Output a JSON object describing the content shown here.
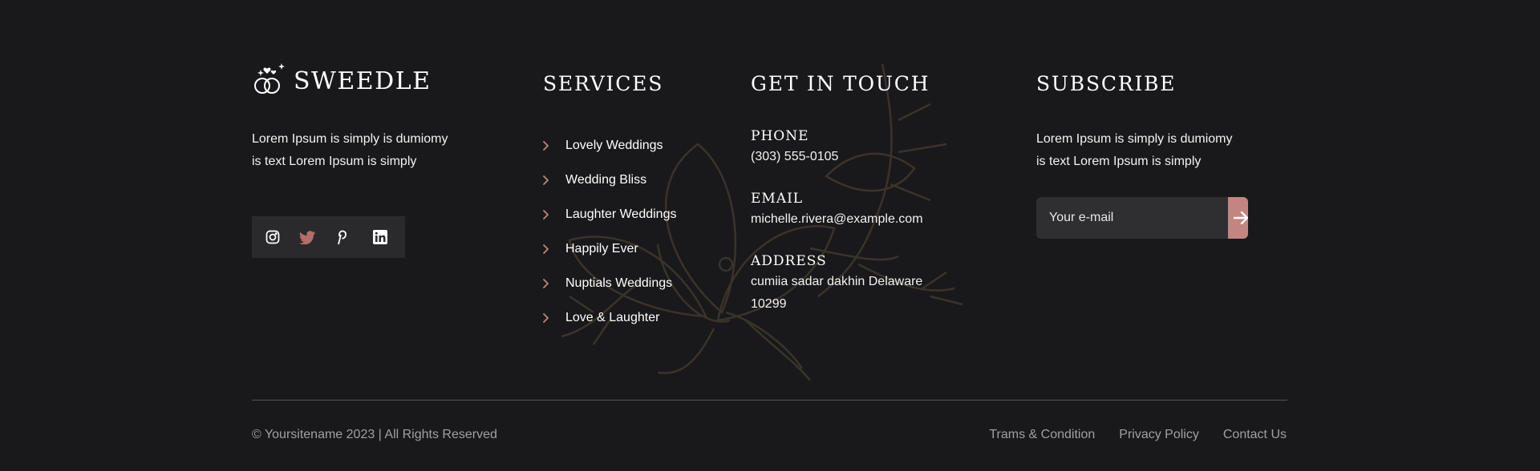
{
  "brand": {
    "name": "SWEEDLE",
    "accent_color": "#c48580"
  },
  "about": {
    "text_line1": "Lorem Ipsum is simply is dumiomy",
    "text_line2": "is text Lorem Ipsum is simply"
  },
  "social": {
    "icons": [
      "instagram-icon",
      "twitter-icon",
      "pinterest-icon",
      "linkedin-icon"
    ]
  },
  "services": {
    "heading": "SERVICES",
    "items": [
      "Lovely Weddings",
      "Wedding Bliss",
      "Laughter Weddings",
      "Happily Ever",
      "Nuptials Weddings",
      "Love & Laughter"
    ]
  },
  "contact": {
    "heading": "GET IN TOUCH",
    "phone_label": "PHONE",
    "phone": "(303) 555-0105",
    "email_label": "EMAIL",
    "email": "michelle.rivera@example.com",
    "address_label": "ADDRESS",
    "address_line1": "cumiia sadar dakhin Delaware",
    "address_line2": "10299"
  },
  "subscribe": {
    "heading": "SUBSCRIBE",
    "text_line1": "Lorem Ipsum is simply is dumiomy",
    "text_line2": "is text Lorem Ipsum is simply",
    "placeholder": "Your e-mail"
  },
  "footer": {
    "copyright": "© Yoursitename  2023 | All Rights Reserved",
    "links": [
      "Trams & Condition",
      "Privacy Policy",
      "Contact Us"
    ]
  }
}
